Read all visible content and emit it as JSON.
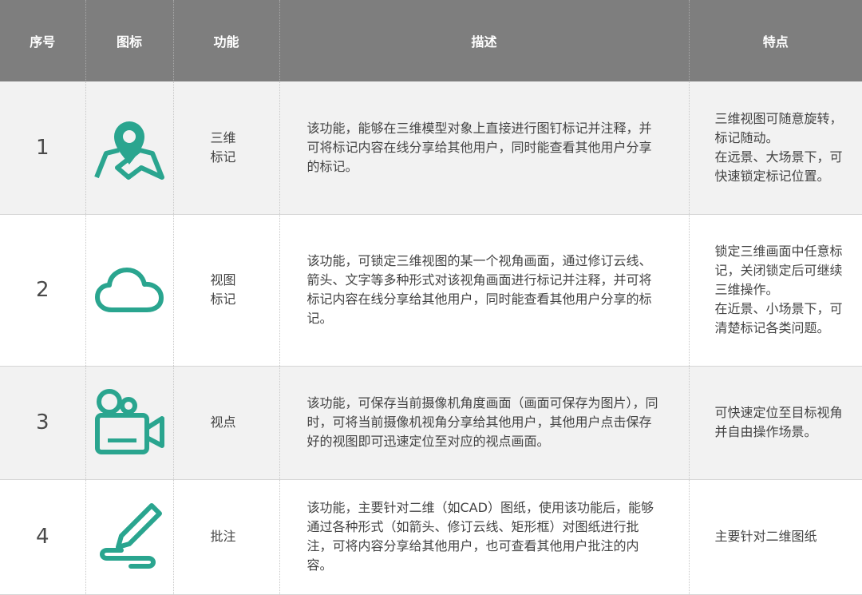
{
  "accent_color": "#2aa58f",
  "header": {
    "index": "序号",
    "icon": "图标",
    "function": "功能",
    "description": "描述",
    "feature": "特点"
  },
  "rows": [
    {
      "index": "1",
      "icon": "map-pin-icon",
      "function": "三维标记",
      "description": "该功能，能够在三维模型对象上直接进行图钉标记并注释，并可将标记内容在线分享给其他用户，同时能查看其他用户分享的标记。",
      "feature": "三维视图可随意旋转，标记随动。\n在远景、大场景下，可快速锁定标记位置。"
    },
    {
      "index": "2",
      "icon": "cloud-icon",
      "function": "视图标记",
      "description": "该功能，可锁定三维视图的某一个视角画面，通过修订云线、箭头、文字等多种形式对该视角画面进行标记并注释，并可将标记内容在线分享给其他用户，同时能查看其他用户分享的标记。",
      "feature": "锁定三维画面中任意标记，关闭锁定后可继续三维操作。\n在近景、小场景下，可清楚标记各类问题。"
    },
    {
      "index": "3",
      "icon": "video-camera-icon",
      "function": "视点",
      "description": "该功能，可保存当前摄像机角度画面（画面可保存为图片），同时，可将当前摄像机视角分享给其他用户，其他用户点击保存好的视图即可迅速定位至对应的视点画面。",
      "feature": "可快速定位至目标视角并自由操作场景。"
    },
    {
      "index": "4",
      "icon": "pen-icon",
      "function": "批注",
      "description": "该功能，主要针对二维（如CAD）图纸，使用该功能后，能够通过各种形式（如箭头、修订云线、矩形框）对图纸进行批注，可将内容分享给其他用户，也可查看其他用户批注的内容。",
      "feature": "主要针对二维图纸"
    }
  ]
}
